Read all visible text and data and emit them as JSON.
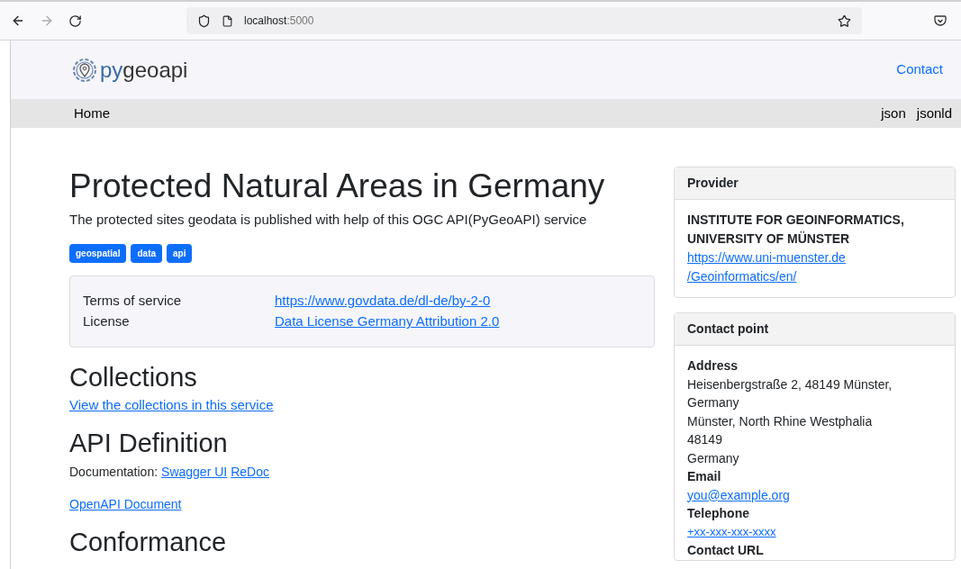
{
  "browser": {
    "url_host": "localhost",
    "url_port": ":5000"
  },
  "header": {
    "logo_prefix": "py",
    "logo_suffix": "geoapi",
    "contact": "Contact"
  },
  "nav": {
    "home": "Home",
    "formats": [
      "json",
      "jsonld"
    ]
  },
  "main": {
    "title": "Protected Natural Areas in Germany",
    "description": "The protected sites geodata is published with help of this OGC API(PyGeoAPI) service",
    "keywords": [
      "geospatial",
      "data",
      "api"
    ],
    "terms": [
      {
        "label": "Terms of service",
        "link": "https://www.govdata.de/dl-de/by-2-0"
      },
      {
        "label": "License",
        "link": "Data License Germany Attribution 2.0"
      }
    ],
    "collections": {
      "heading": "Collections",
      "link": "View the collections in this service"
    },
    "api": {
      "heading": "API Definition",
      "doc_label": "Documentation:",
      "doc_links": [
        "Swagger UI",
        "ReDoc"
      ],
      "openapi": "OpenAPI Document"
    },
    "conformance": {
      "heading": "Conformance"
    }
  },
  "provider": {
    "heading": "Provider",
    "name": "INSTITUTE FOR GEOINFORMATICS, UNIVERSITY OF MÜNSTER",
    "url_lines": [
      "https://www.uni-muenster.de",
      "/Geoinformatics/en/"
    ]
  },
  "contact_point": {
    "heading": "Contact point",
    "address_label": "Address",
    "address_lines": [
      "Heisenbergstraße 2, 48149 Münster, Germany",
      "Münster, North Rhine Westphalia",
      "48149",
      "Germany"
    ],
    "email_label": "Email",
    "email": "you@example.org",
    "telephone_label": "Telephone",
    "telephone": "+xx-xxx-xxx-xxxx",
    "url_label": "Contact URL"
  }
}
